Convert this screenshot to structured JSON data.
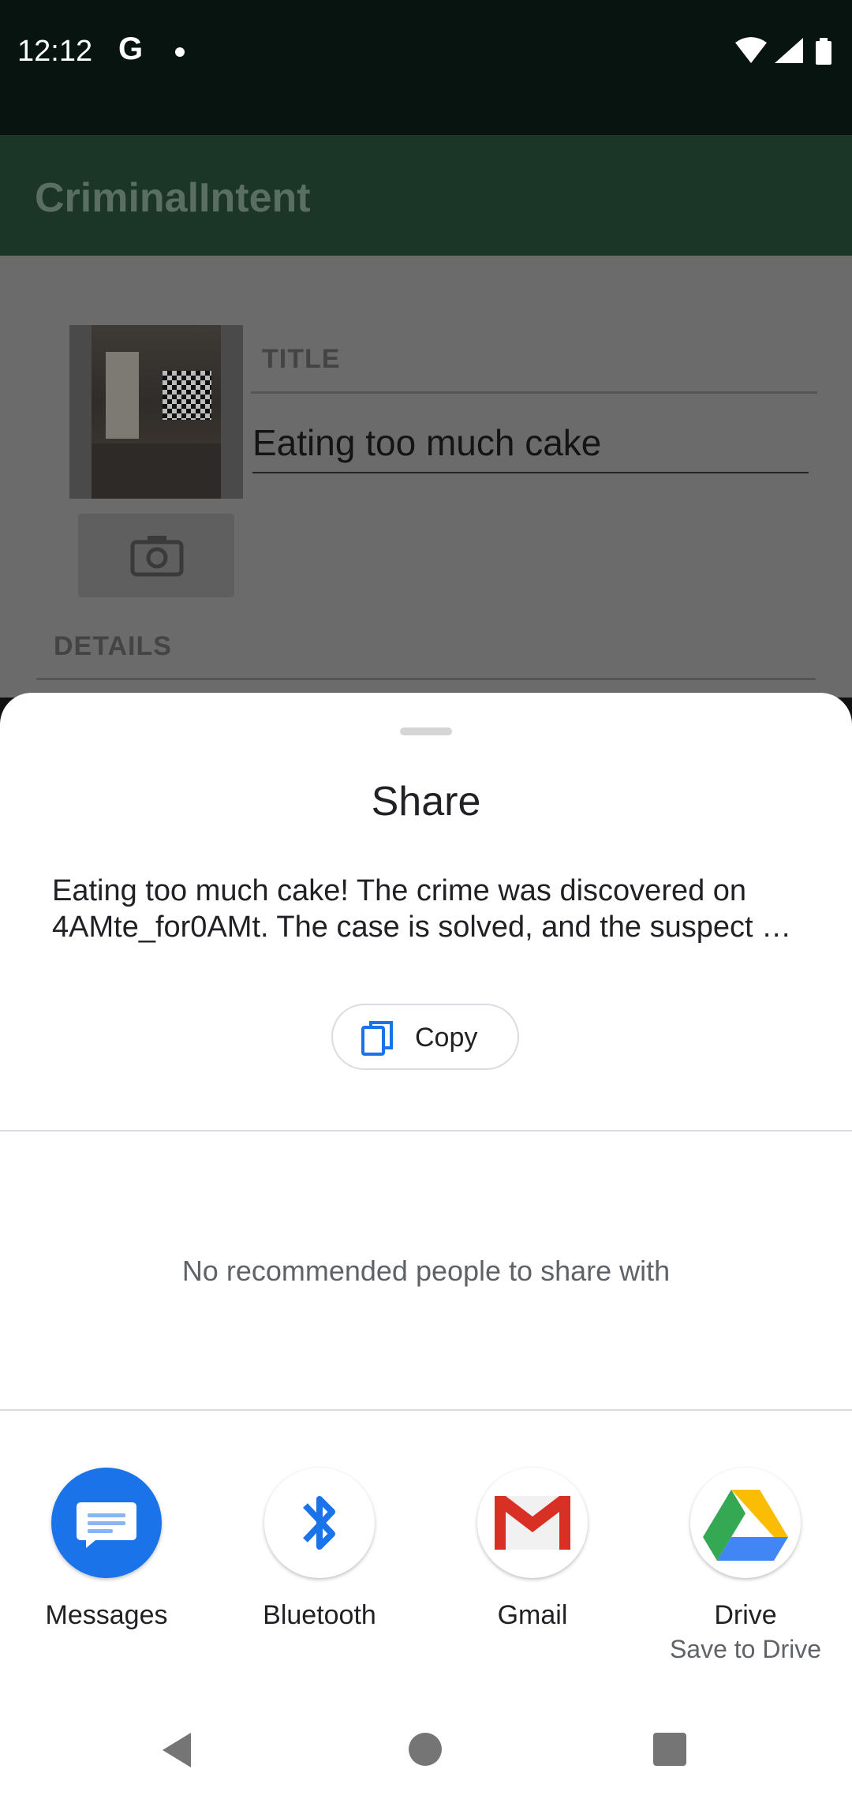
{
  "status_bar": {
    "time": "12:12",
    "g_letter": "G",
    "icons": [
      "wifi-icon",
      "signal-icon",
      "battery-icon"
    ]
  },
  "app": {
    "title": "CriminalIntent",
    "title_label": "TITLE",
    "title_value": "Eating too much cake",
    "details_label": "DETAILS"
  },
  "share_sheet": {
    "title": "Share",
    "text": "Eating too much cake! The crime was discovered on 4AMte_for0AMt. The case is solved, and the suspect …",
    "copy_label": "Copy",
    "no_recommendations": "No recommended people to share with",
    "targets": [
      {
        "label": "Messages",
        "sub": ""
      },
      {
        "label": "Bluetooth",
        "sub": ""
      },
      {
        "label": "Gmail",
        "sub": ""
      },
      {
        "label": "Drive",
        "sub": "Save to Drive"
      }
    ]
  },
  "colors": {
    "accent_blue": "#1a73e8",
    "messages_blue": "#1a73e8",
    "gmail_red": "#d93025"
  }
}
